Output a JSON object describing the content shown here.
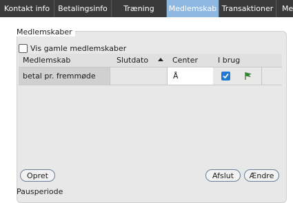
{
  "tabs": [
    {
      "label": "Kontakt info",
      "active": false
    },
    {
      "label": "Betalingsinfo",
      "active": false
    },
    {
      "label": "Træning",
      "active": false
    },
    {
      "label": "Medlemskab",
      "active": true
    },
    {
      "label": "Transaktioner",
      "active": false
    },
    {
      "label": "Me",
      "active": false
    }
  ],
  "group": {
    "title": "Medlemskaber",
    "show_old_label": "Vis gamle medlemskaber",
    "show_old_checked": false
  },
  "table": {
    "columns": [
      "Medlemskab",
      "Slutdato",
      "Center",
      "I brug"
    ],
    "sort_column": "Slutdato",
    "sort_direction": "ascending",
    "rows": [
      {
        "medlemskab": "betal pr. fremmøde",
        "slutdato": "",
        "center": "Å",
        "i_brug": true,
        "icon": "flag-icon"
      }
    ]
  },
  "buttons": {
    "opret": "Opret",
    "afslut": "Afslut",
    "aendre": "Ændre"
  },
  "footer_label": "Pausperiode",
  "colors": {
    "tabbar_bg": "#3a3a3a",
    "active_tab_bg": "#8fb8e0",
    "checkbox_blue": "#1f78d1",
    "flag_green": "#2a8a2a"
  }
}
